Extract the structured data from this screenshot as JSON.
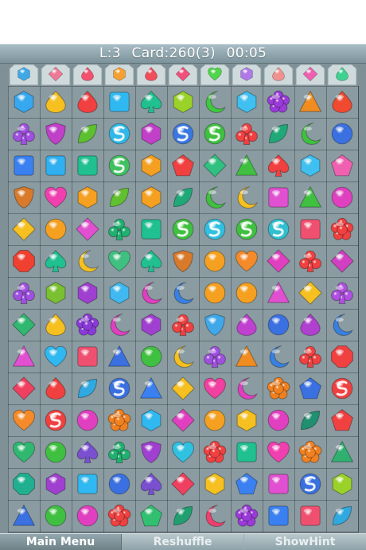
{
  "status": {
    "level": "L:3",
    "card": "Card:260(3)",
    "time": "00:05"
  },
  "reserve": [
    {
      "shape": "hexagon",
      "color": "#3ea8e8"
    },
    {
      "shape": "diamond",
      "color": "#f07a96"
    },
    {
      "shape": "drop",
      "color": "#f2506e"
    },
    {
      "shape": "hexagon",
      "color": "#f5a030"
    },
    {
      "shape": "drop",
      "color": "#f04e5a"
    },
    {
      "shape": "diamond",
      "color": "#f0507a"
    },
    {
      "shape": "heart",
      "color": "#4fd64a"
    },
    {
      "shape": "hexagon",
      "color": "#b07ae6"
    },
    {
      "shape": "drop",
      "color": "#f09090"
    },
    {
      "shape": "diamond",
      "color": "#f060b0"
    },
    {
      "shape": "drop",
      "color": "#40d090"
    }
  ],
  "board": [
    [
      [
        "hexagon",
        "#36a8f0"
      ],
      [
        "drop",
        "#f5c020"
      ],
      [
        "drop",
        "#f04040"
      ],
      [
        "square",
        "#30b8f0"
      ],
      [
        "spade",
        "#20c090"
      ],
      [
        "hexagon",
        "#9ad22a"
      ],
      [
        "moon",
        "#40c840"
      ],
      [
        "hexagon",
        "#40c0f0"
      ],
      [
        "flower",
        "#9a3ad8"
      ],
      [
        "triangle",
        "#f08c20"
      ],
      [
        "drop",
        "#f04a30"
      ]
    ],
    [
      [
        "club",
        "#a050e0"
      ],
      [
        "shield",
        "#c040c8"
      ],
      [
        "leaf",
        "#5cc030"
      ],
      [
        "swirl",
        "#30b8e8"
      ],
      [
        "hexagon",
        "#c040c8"
      ],
      [
        "swirl",
        "#3a78e0"
      ],
      [
        "swirl",
        "#40c040"
      ],
      [
        "club",
        "#f04040"
      ],
      [
        "leaf",
        "#20a878"
      ],
      [
        "moon",
        "#40c040"
      ],
      [
        "circle",
        "#3a70e0"
      ]
    ],
    [
      [
        "square",
        "#3a80f0"
      ],
      [
        "square",
        "#30b0f0"
      ],
      [
        "square",
        "#20c090"
      ],
      [
        "swirl",
        "#40c060"
      ],
      [
        "hexagon",
        "#f5a020"
      ],
      [
        "pentagon",
        "#f04040"
      ],
      [
        "diamond",
        "#30c080"
      ],
      [
        "triangle",
        "#40c040"
      ],
      [
        "spade",
        "#f04040"
      ],
      [
        "hexagon",
        "#40c0f0"
      ],
      [
        "pentagon",
        "#f060b0"
      ]
    ],
    [
      [
        "shield",
        "#d87a2a"
      ],
      [
        "heart",
        "#f040b0"
      ],
      [
        "hexagon",
        "#f5a020"
      ],
      [
        "leaf",
        "#60c030"
      ],
      [
        "hexagon",
        "#f5a020"
      ],
      [
        "leaf",
        "#20a878"
      ],
      [
        "moon",
        "#40c040"
      ],
      [
        "moon",
        "#f5c020"
      ],
      [
        "square",
        "#e050d0"
      ],
      [
        "triangle",
        "#40c040"
      ],
      [
        "circle",
        "#e040c0"
      ]
    ],
    [
      [
        "diamond",
        "#f5c020"
      ],
      [
        "circle",
        "#f5a020"
      ],
      [
        "diamond",
        "#e050d0"
      ],
      [
        "club",
        "#20b070"
      ],
      [
        "square",
        "#20c090"
      ],
      [
        "swirl",
        "#40c040"
      ],
      [
        "swirl",
        "#30c0e0"
      ],
      [
        "swirl",
        "#40c040"
      ],
      [
        "swirl",
        "#30c0d0"
      ],
      [
        "square",
        "#f05070"
      ],
      [
        "flower",
        "#f04040"
      ]
    ],
    [
      [
        "octagon",
        "#f04030"
      ],
      [
        "spade",
        "#20c090"
      ],
      [
        "moon",
        "#f5c020"
      ],
      [
        "heart",
        "#40c080"
      ],
      [
        "spade",
        "#20c090"
      ],
      [
        "shield",
        "#d87a2a"
      ],
      [
        "circle",
        "#f5a020"
      ],
      [
        "heart",
        "#f58a2a"
      ],
      [
        "diamond",
        "#e040c0"
      ],
      [
        "club",
        "#f04040"
      ],
      [
        "diamond",
        "#d040c0"
      ]
    ],
    [
      [
        "club",
        "#a050e0"
      ],
      [
        "hexagon",
        "#7ac030"
      ],
      [
        "hexagon",
        "#a040d0"
      ],
      [
        "hexagon",
        "#40b8f0"
      ],
      [
        "moon",
        "#e040c0"
      ],
      [
        "moon",
        "#3a80e0"
      ],
      [
        "circle",
        "#f5a020"
      ],
      [
        "circle",
        "#f5a020"
      ],
      [
        "triangle",
        "#e050d0"
      ],
      [
        "diamond",
        "#f5c020"
      ],
      [
        "club",
        "#b050e0"
      ]
    ],
    [
      [
        "diamond",
        "#30b870"
      ],
      [
        "drop",
        "#f5c020"
      ],
      [
        "flower",
        "#8a3ad8"
      ],
      [
        "moon",
        "#e040c0"
      ],
      [
        "hexagon",
        "#a040d0"
      ],
      [
        "club",
        "#f04040"
      ],
      [
        "shield",
        "#40a8e8"
      ],
      [
        "drop",
        "#c040d0"
      ],
      [
        "circle",
        "#3a70e0"
      ],
      [
        "drop",
        "#b040d0"
      ],
      [
        "moon",
        "#3a80e0"
      ]
    ],
    [
      [
        "triangle",
        "#e050d0"
      ],
      [
        "heart",
        "#30b8f0"
      ],
      [
        "square",
        "#f05070"
      ],
      [
        "triangle",
        "#3a70e0"
      ],
      [
        "circle",
        "#40c040"
      ],
      [
        "moon",
        "#f5c020"
      ],
      [
        "club",
        "#a050e0"
      ],
      [
        "triangle",
        "#f08c20"
      ],
      [
        "moon",
        "#3a80e0"
      ],
      [
        "club",
        "#f04040"
      ],
      [
        "octagon",
        "#f04040"
      ]
    ],
    [
      [
        "diamond",
        "#f04060"
      ],
      [
        "drop",
        "#f04040"
      ],
      [
        "leaf",
        "#30a8e0"
      ],
      [
        "swirl",
        "#3a70e0"
      ],
      [
        "triangle",
        "#3a80f0"
      ],
      [
        "diamond",
        "#f5c020"
      ],
      [
        "heart",
        "#f040a0"
      ],
      [
        "moon",
        "#e040c0"
      ],
      [
        "flower",
        "#f08020"
      ],
      [
        "pentagon",
        "#3a70e0"
      ],
      [
        "swirl",
        "#f04040"
      ]
    ],
    [
      [
        "heart",
        "#f58a2a"
      ],
      [
        "swirl",
        "#f04040"
      ],
      [
        "circle",
        "#e040c0"
      ],
      [
        "flower",
        "#f08020"
      ],
      [
        "hexagon",
        "#30b8f0"
      ],
      [
        "diamond",
        "#e040c0"
      ],
      [
        "circle",
        "#f5a020"
      ],
      [
        "hexagon",
        "#f5c020"
      ],
      [
        "circle",
        "#e040c0"
      ],
      [
        "leaf",
        "#209070"
      ],
      [
        "pentagon",
        "#f04040"
      ]
    ],
    [
      [
        "heart",
        "#30b870"
      ],
      [
        "circle",
        "#40c040"
      ],
      [
        "spade",
        "#7a50d0"
      ],
      [
        "club",
        "#20b070"
      ],
      [
        "shield",
        "#a040d0"
      ],
      [
        "heart",
        "#30c0e0"
      ],
      [
        "flower",
        "#f04040"
      ],
      [
        "square",
        "#20c090"
      ],
      [
        "heart",
        "#f040b0"
      ],
      [
        "flower",
        "#f08020"
      ],
      [
        "triangle",
        "#30b070"
      ]
    ],
    [
      [
        "octagon",
        "#20b090"
      ],
      [
        "hexagon",
        "#a040d0"
      ],
      [
        "square",
        "#30b8f0"
      ],
      [
        "circle",
        "#3a70e0"
      ],
      [
        "spade",
        "#7a50d0"
      ],
      [
        "diamond",
        "#f04060"
      ],
      [
        "hexagon",
        "#f5c020"
      ],
      [
        "pentagon",
        "#3a80f0"
      ],
      [
        "square",
        "#e050d0"
      ],
      [
        "swirl",
        "#3a70e0"
      ],
      [
        "hexagon",
        "#9ad22a"
      ]
    ],
    [
      [
        "triangle",
        "#3a70e0"
      ],
      [
        "circle",
        "#40c040"
      ],
      [
        "circle",
        "#e040c0"
      ],
      [
        "flower",
        "#f04040"
      ],
      [
        "pentagon",
        "#30c070"
      ],
      [
        "leaf",
        "#20a070"
      ],
      [
        "moon",
        "#f04070"
      ],
      [
        "flower",
        "#9a3ad8"
      ],
      [
        "square",
        "#3a80f0"
      ],
      [
        "square",
        "#f05070"
      ],
      [
        "leaf",
        "#30a8e0"
      ]
    ]
  ],
  "buttons": {
    "main_menu": "Main Menu",
    "reshuffle": "Reshuffle",
    "show_hint": "ShowHint"
  }
}
